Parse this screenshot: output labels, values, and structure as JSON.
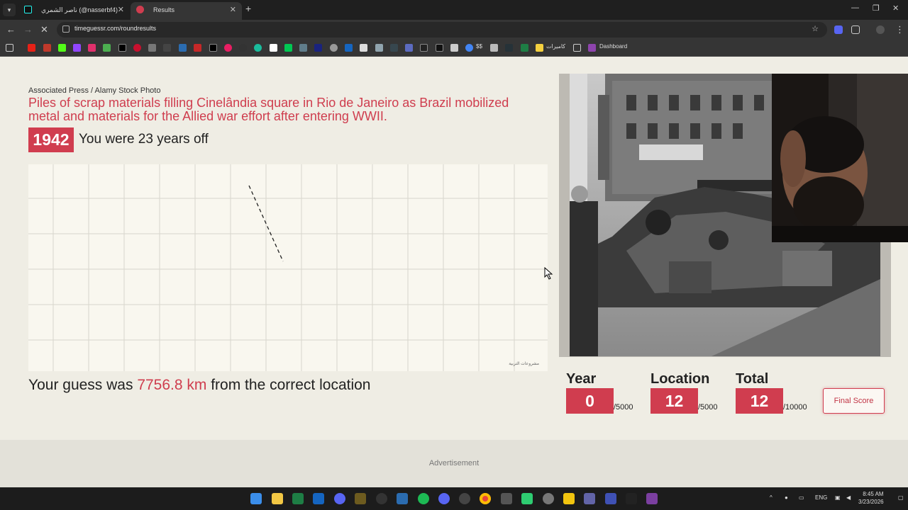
{
  "browser": {
    "tabs": [
      {
        "title": "ناصر الشمري (@nasserbf4)",
        "active": false,
        "icon": "tiktok-icon"
      },
      {
        "title": "Results",
        "active": true,
        "icon": "site-icon"
      }
    ],
    "new_tab_glyph": "+",
    "url": "timeguessr.com/roundresults",
    "bookmarks": [
      {
        "label": "$$"
      },
      {
        "label": "كاميرات"
      },
      {
        "label": "Dashboard"
      }
    ]
  },
  "result": {
    "photo_credit": "Associated Press / Alamy Stock Photo",
    "caption": "Piles of scrap materials filling Cinelândia square in Rio de Janeiro as Brazil mobilized metal and materials for the Allied war effort after entering WWII.",
    "year": "1942",
    "years_off_text": "You were 23 years off",
    "guess_prefix": "Your guess was ",
    "guess_distance": "7756.8 km",
    "guess_suffix": " from the correct location",
    "map_attribution": "مشروعات التربية"
  },
  "scores": {
    "year": {
      "label": "Year",
      "value": "0",
      "max": "/5000"
    },
    "location": {
      "label": "Location",
      "value": "12",
      "max": "/5000"
    },
    "total": {
      "label": "Total",
      "value": "12",
      "max": "/10000"
    }
  },
  "final_score_label": "Final Score",
  "advertisement_label": "Advertisement",
  "taskbar": {
    "language": "ENG",
    "time": "8:45 AM",
    "date": "3/23/2026"
  },
  "colors": {
    "accent": "#d03d4f",
    "page_bg": "#efede4",
    "map_bg": "#f9f7ef",
    "chrome_dark": "#1f1f1f"
  }
}
